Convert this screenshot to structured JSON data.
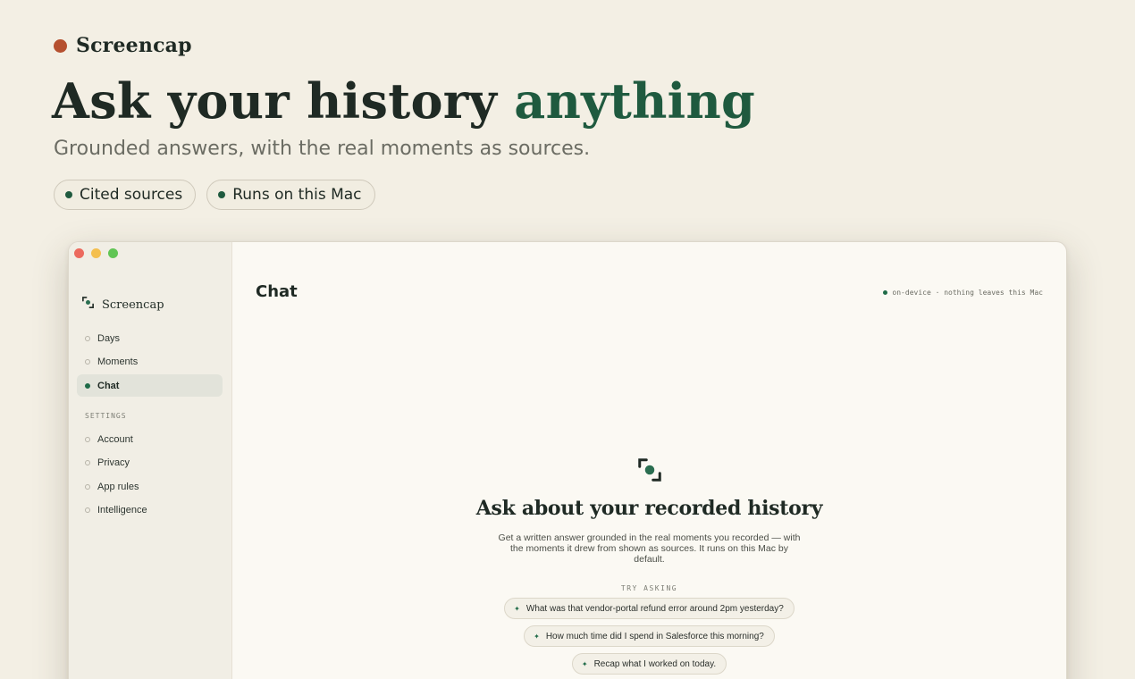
{
  "hero": {
    "brand": "Screencap",
    "headline_lead": "Ask your history ",
    "headline_accent": "anything",
    "subhead": "Grounded answers, with the real moments as sources.",
    "pills": [
      "Cited sources",
      "Runs on this Mac"
    ]
  },
  "window": {
    "traffic_lights": [
      "close",
      "minimize",
      "zoom"
    ],
    "sidebar": {
      "brand": "Screencap",
      "items": [
        {
          "label": "Days",
          "active": false
        },
        {
          "label": "Moments",
          "active": false
        },
        {
          "label": "Chat",
          "active": true
        }
      ],
      "settings_label": "SETTINGS",
      "settings_items": [
        {
          "label": "Account"
        },
        {
          "label": "Privacy"
        },
        {
          "label": "App rules"
        },
        {
          "label": "Intelligence"
        }
      ]
    },
    "main": {
      "title": "Chat",
      "status": "on-device · nothing leaves this Mac",
      "empty_state": {
        "icon": "screencap-focus-icon",
        "title": "Ask about your recorded history",
        "body": "Get a written answer grounded in the real moments you recorded — with the moments it drew from shown as sources. It runs on this Mac by default.",
        "try_label": "TRY ASKING",
        "suggestions": [
          "What was that vendor-portal refund error around 2pm yesterday?",
          "How much time did I spend in Salesforce this morning?",
          "Recap what I worked on today."
        ]
      }
    }
  },
  "colors": {
    "background": "#f3efe4",
    "accent_green": "#1f5a3f",
    "brand_dot": "#b5502f"
  }
}
